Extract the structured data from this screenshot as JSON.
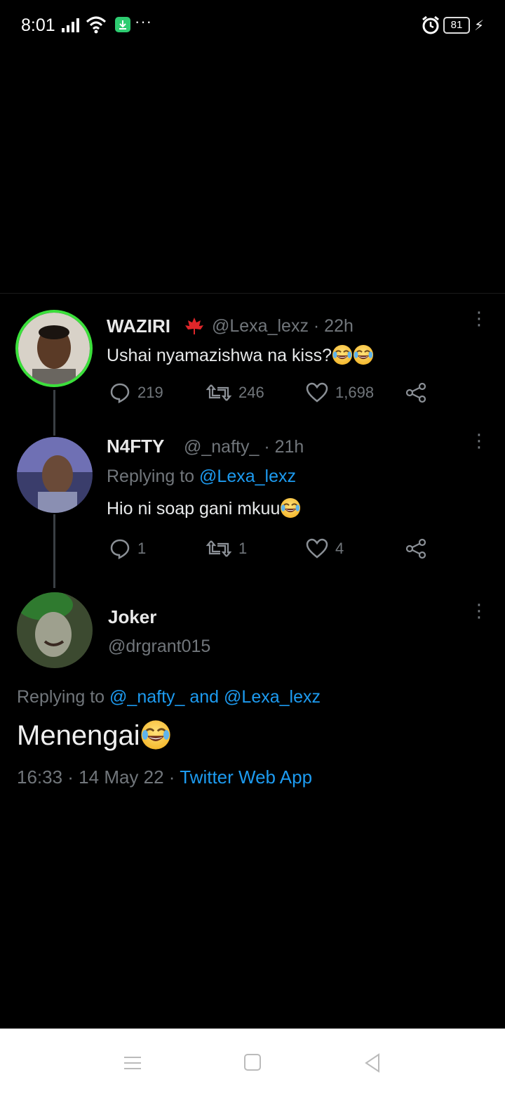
{
  "status_bar": {
    "time": "8:01",
    "dots": "···",
    "battery": "81",
    "icons": [
      "signal-icon",
      "wifi-icon",
      "download-icon",
      "alarm-icon",
      "battery-icon",
      "charging-icon"
    ]
  },
  "tweets": [
    {
      "name": "WAZIRI",
      "flag_icon": "maple-leaf-icon",
      "handle": "@Lexa_lexz · 22h",
      "text": "Ushai nyamazishwa na kiss?",
      "emojis": [
        "laughing-emoji",
        "laughing-emoji"
      ],
      "replies": "219",
      "retweets": "246",
      "likes": "1,698"
    },
    {
      "name": "N4FTY",
      "handle": "@_nafty_ · 21h",
      "replying_prefix": "Replying to ",
      "replying_to": "@Lexa_lexz",
      "text": "Hio ni soap gani mkuu",
      "emojis": [
        "laughing-emoji"
      ],
      "replies": "1",
      "retweets": "1",
      "likes": "4"
    }
  ],
  "main_tweet": {
    "name": "Joker",
    "handle": "@drgrant015",
    "replying_prefix": "Replying to ",
    "replying_to_1": "@_nafty_",
    "replying_and": " and ",
    "replying_to_2": "@Lexa_lexz",
    "text": "Menengai",
    "emojis": [
      "laughing-emoji"
    ],
    "timestamp": "16:33 · 14 May 22 · ",
    "source": "Twitter Web App"
  },
  "nav_bar": {
    "icons": [
      "menu-icon",
      "home-icon",
      "back-icon"
    ]
  },
  "colors": {
    "background": "#000000",
    "link": "#1d9bf0",
    "muted": "#71767b",
    "avatar_ring": "#3be03b"
  }
}
